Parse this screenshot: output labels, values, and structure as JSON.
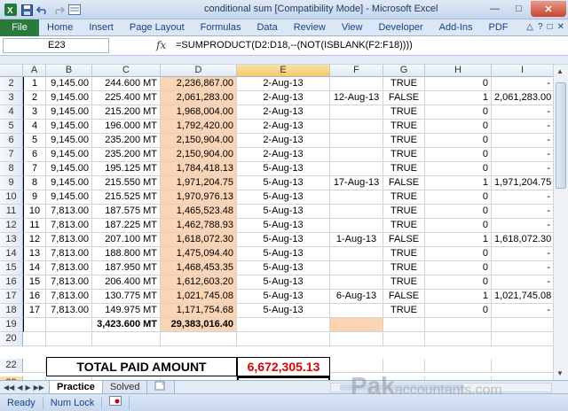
{
  "titlebar": {
    "title": "conditional sum  [Compatibility Mode]  -  Microsoft Excel",
    "app_icon": "excel-icon",
    "qat_icons": [
      "save-icon",
      "undo-icon",
      "redo-icon",
      "form-icon"
    ],
    "controls": [
      "minimize",
      "maximize",
      "close"
    ]
  },
  "ribbon": {
    "file_tab": "File",
    "tabs": [
      "Home",
      "Insert",
      "Page Layout",
      "Formulas",
      "Data",
      "Review",
      "View",
      "Developer",
      "Add-Ins",
      "PDF"
    ]
  },
  "formula_bar": {
    "name_box": "E23",
    "fx": "fx",
    "formula": "=SUMPRODUCT(D2:D18,--(NOT(ISBLANK(F2:F18))))"
  },
  "columns": [
    "A",
    "B",
    "C",
    "D",
    "E",
    "F",
    "G",
    "H",
    "I"
  ],
  "selected_column": "E",
  "rows": [
    {
      "row": "2",
      "a": "1",
      "b": "9,145.00",
      "c": "244.600 MT",
      "d": "2,236,867.00",
      "e": "2-Aug-13",
      "f": "",
      "g": "TRUE",
      "h": "0",
      "i": "-"
    },
    {
      "row": "3",
      "a": "2",
      "b": "9,145.00",
      "c": "225.400 MT",
      "d": "2,061,283.00",
      "e": "2-Aug-13",
      "f": "12-Aug-13",
      "g": "FALSE",
      "h": "1",
      "i": "2,061,283.00"
    },
    {
      "row": "4",
      "a": "3",
      "b": "9,145.00",
      "c": "215.200 MT",
      "d": "1,968,004.00",
      "e": "2-Aug-13",
      "f": "",
      "g": "TRUE",
      "h": "0",
      "i": "-"
    },
    {
      "row": "5",
      "a": "4",
      "b": "9,145.00",
      "c": "196.000 MT",
      "d": "1,792,420.00",
      "e": "2-Aug-13",
      "f": "",
      "g": "TRUE",
      "h": "0",
      "i": "-"
    },
    {
      "row": "6",
      "a": "5",
      "b": "9,145.00",
      "c": "235.200 MT",
      "d": "2,150,904.00",
      "e": "2-Aug-13",
      "f": "",
      "g": "TRUE",
      "h": "0",
      "i": "-"
    },
    {
      "row": "7",
      "a": "6",
      "b": "9,145.00",
      "c": "235.200 MT",
      "d": "2,150,904.00",
      "e": "2-Aug-13",
      "f": "",
      "g": "TRUE",
      "h": "0",
      "i": "-"
    },
    {
      "row": "8",
      "a": "7",
      "b": "9,145.00",
      "c": "195.125 MT",
      "d": "1,784,418.13",
      "e": "5-Aug-13",
      "f": "",
      "g": "TRUE",
      "h": "0",
      "i": "-"
    },
    {
      "row": "9",
      "a": "8",
      "b": "9,145.00",
      "c": "215.550 MT",
      "d": "1,971,204.75",
      "e": "5-Aug-13",
      "f": "17-Aug-13",
      "g": "FALSE",
      "h": "1",
      "i": "1,971,204.75"
    },
    {
      "row": "10",
      "a": "9",
      "b": "9,145.00",
      "c": "215.525 MT",
      "d": "1,970,976.13",
      "e": "5-Aug-13",
      "f": "",
      "g": "TRUE",
      "h": "0",
      "i": "-"
    },
    {
      "row": "11",
      "a": "10",
      "b": "7,813.00",
      "c": "187.575 MT",
      "d": "1,465,523.48",
      "e": "5-Aug-13",
      "f": "",
      "g": "TRUE",
      "h": "0",
      "i": "-"
    },
    {
      "row": "12",
      "a": "11",
      "b": "7,813.00",
      "c": "187.225 MT",
      "d": "1,462,788.93",
      "e": "5-Aug-13",
      "f": "",
      "g": "TRUE",
      "h": "0",
      "i": "-"
    },
    {
      "row": "13",
      "a": "12",
      "b": "7,813.00",
      "c": "207.100 MT",
      "d": "1,618,072.30",
      "e": "5-Aug-13",
      "f": "1-Aug-13",
      "g": "FALSE",
      "h": "1",
      "i": "1,618,072.30"
    },
    {
      "row": "14",
      "a": "13",
      "b": "7,813.00",
      "c": "188.800 MT",
      "d": "1,475,094.40",
      "e": "5-Aug-13",
      "f": "",
      "g": "TRUE",
      "h": "0",
      "i": "-"
    },
    {
      "row": "15",
      "a": "14",
      "b": "7,813.00",
      "c": "187.950 MT",
      "d": "1,468,453.35",
      "e": "5-Aug-13",
      "f": "",
      "g": "TRUE",
      "h": "0",
      "i": "-"
    },
    {
      "row": "16",
      "a": "15",
      "b": "7,813.00",
      "c": "206.400 MT",
      "d": "1,612,603.20",
      "e": "5-Aug-13",
      "f": "",
      "g": "TRUE",
      "h": "0",
      "i": "-"
    },
    {
      "row": "17",
      "a": "16",
      "b": "7,813.00",
      "c": "130.775 MT",
      "d": "1,021,745.08",
      "e": "5-Aug-13",
      "f": "6-Aug-13",
      "g": "FALSE",
      "h": "1",
      "i": "1,021,745.08"
    },
    {
      "row": "18",
      "a": "17",
      "b": "7,813.00",
      "c": "149.975 MT",
      "d": "1,171,754.68",
      "e": "5-Aug-13",
      "f": "",
      "g": "TRUE",
      "h": "0",
      "i": "-"
    }
  ],
  "totals_row": {
    "row": "19",
    "c": "3,423.600 MT",
    "d": "29,383,016.40"
  },
  "blank_row": "20",
  "summary": {
    "row": "22",
    "label": "TOTAL PAID AMOUNT",
    "value": "6,672,305.13"
  },
  "active_cell": {
    "row": "23",
    "value": "6,672,305.13"
  },
  "sheets": [
    {
      "name": "Practice",
      "active": true
    },
    {
      "name": "Solved",
      "active": false
    }
  ],
  "status": {
    "ready": "Ready",
    "num_lock": "Num Lock"
  },
  "watermark": {
    "text": "Pak",
    "suffix": "accountants.com"
  },
  "colors": {
    "peach": "#fbd4b4",
    "total_red": "#e00000",
    "file_tab": "#2a7a3b"
  }
}
